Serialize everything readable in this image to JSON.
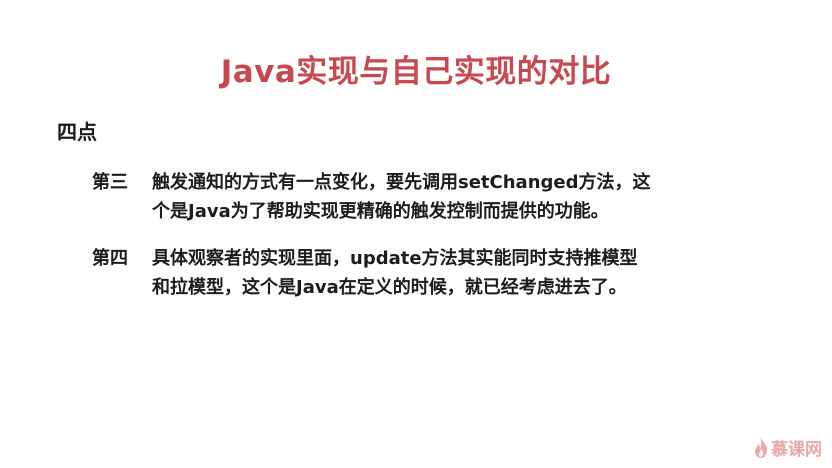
{
  "slide": {
    "title": "Java实现与自己实现的对比",
    "section_heading": "四点",
    "points": [
      {
        "label": "第三",
        "line1": "触发通知的方式有一点变化，要先调用setChanged方法，这",
        "line2": "个是Java为了帮助实现更精确的触发控制而提供的功能。"
      },
      {
        "label": "第四",
        "line1": "具体观察者的实现里面，update方法其实能同时支持推模型",
        "line2": "和拉模型，这个是Java在定义的时候，就已经考虑进去了。"
      }
    ]
  },
  "logo": {
    "text": "慕课网",
    "icon": "flame-icon",
    "color": "#e9a9a9"
  },
  "colors": {
    "title": "#c9484f",
    "text": "#1c1c1c"
  }
}
